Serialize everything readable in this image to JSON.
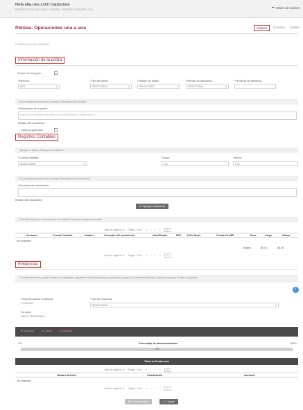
{
  "header": {
    "user": "Hola alla.ruis.xxt1/ Capturista",
    "subtitle": "PARTIDO ACCIÓN NACIONAL / FEDERAL / INFORME ORDINARIO 2021",
    "back_label": "Volver al menú m"
  },
  "page": {
    "title": "Pólizas. Operaciones una a una",
    "tabs": [
      {
        "label": "Captura",
        "active": true
      },
      {
        "label": "Consulta",
        "active": false
      },
      {
        "label": "Modific",
        "active": false
      }
    ],
    "required_note": "Los datos con (*) son requeridos"
  },
  "poliza": {
    "section_title": "Información de la póliza",
    "enviar_prorrogoto_label": "Enviar a Prorrogoto:",
    "ejercicio_label": "*Ejercicio:",
    "ejercicio_value": "2021",
    "tipo_label": "*Tipo de póliza:",
    "tipo_value": "SELECCIONA",
    "subtipo_label": "*Subtipo de póliza:",
    "subtipo_value": "SELECCIONA",
    "periodo_label": "*Periodo de operación:",
    "periodo_value": "SELECCIONA",
    "fecha_label": "*Fecha de la operación:",
    "accent_banner": "No se aceptarán acentos en el campo (Descripción de la póliza)",
    "descripcion_label": "*Descripción de la póliza:",
    "descripcion_placeholder": "FAVOR DE ESCRIBIR UNA BREVE DESCRIPCIÓN O COMENTARIOS",
    "restan_label": "Restan 300 caracteres.",
    "gasto_label": "Gasto programado:"
  },
  "registros": {
    "section_title": "Registros Contables",
    "cargo_banner": "Agregar un cargo o abono por movimiento.",
    "cuenta_label": "*Cuenta contable:",
    "cuenta_value": "SELECCIONA",
    "cargo_label": "*Cargo:",
    "cargo_value": "0.00",
    "abono_label": "*Abono:",
    "abono_value": "0.00",
    "mov_banner": "No se aceptarán acentos en el campo (Descripción del movimiento)",
    "concepto_label": "*Concepto del movimiento:",
    "restan_label": "Restan 300 caracteres.",
    "agregar_label": "Agregar movimiento",
    "info_banner": "Esta información no se almacenará en el sistema hasta que se guarde la póliza",
    "pager": {
      "total": "Total de registros: 0",
      "page": "Página 1 de 1",
      "size": "10"
    },
    "columns": [
      "Acciones",
      "Cuenta Contable",
      "Nombre",
      "Concepto del movimiento",
      "Identificador",
      "RFC",
      "Folio fiscal",
      "Cuenta CLABE",
      "Otros",
      "Cargo",
      "Abono"
    ],
    "empty": "Sin registros",
    "totales_label": "Totales",
    "total_cargo": "$0.00",
    "total_abono": "$0.00"
  },
  "evidencias": {
    "section_title": "Evidencias",
    "info": "El nombre del archivo puede contener los siguientes caracteres: letras mayúsculas y minúsculas (excepto la ñ, acentos y diéresis), números, espacios en blanco y guiones.",
    "fecha_label": "Fecha de Alta de Evidencia:",
    "fecha_value": "17/11/2021",
    "tipo_label": "*Tipo de evidencia:",
    "tipo_value": "SELECCIONA",
    "formato_label": "Formato:",
    "formato_value": "SIN EXTENSIONES",
    "buttons": [
      "Examinar",
      "Cargar",
      "Cancelar"
    ],
    "progress_left": "0%",
    "progress_title": "Porcentaje de almacenamiento",
    "progress_right": "100%",
    "progress_value": "0%",
    "progress_fraction": 0,
    "table_title": "Tabla de Evidencias",
    "pager": {
      "total": "Total de registros: 0",
      "page": "Página 1 de 1",
      "size": "10"
    },
    "columns": [
      "Nombre Archivo",
      "Clasificación",
      "Acciones"
    ],
    "empty": "Sin registros"
  },
  "footer": {
    "guardar_label": "Guardar póliza",
    "limpiar_label": "Limpiar"
  },
  "colors": {
    "accent": "#9d2449",
    "border_red": "#c0392b",
    "dark": "#4a4a4a"
  }
}
